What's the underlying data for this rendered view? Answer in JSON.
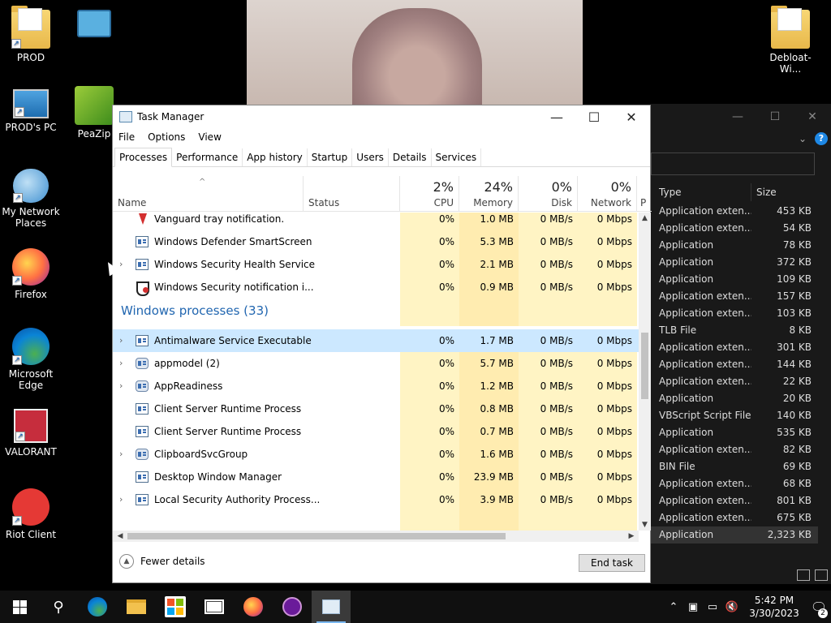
{
  "desktop": {
    "icons": [
      {
        "label": "PROD"
      },
      {
        "label": "PeaZip"
      },
      {
        "label": "PROD's PC"
      },
      {
        "label": "My Network Places"
      },
      {
        "label": "Firefox"
      },
      {
        "label": "Microsoft Edge"
      },
      {
        "label": "VALORANT"
      },
      {
        "label": "Riot Client"
      },
      {
        "label": "Debloat-Wi..."
      }
    ]
  },
  "explorer_bg": {
    "columns": {
      "type": "Type",
      "size": "Size"
    },
    "rows": [
      {
        "type": "Application exten...",
        "size": "453 KB"
      },
      {
        "type": "Application exten...",
        "size": "54 KB"
      },
      {
        "type": "Application",
        "size": "78 KB"
      },
      {
        "type": "Application",
        "size": "372 KB"
      },
      {
        "type": "Application",
        "size": "109 KB"
      },
      {
        "type": "Application exten...",
        "size": "157 KB"
      },
      {
        "type": "Application exten...",
        "size": "103 KB"
      },
      {
        "type": "TLB File",
        "size": "8 KB"
      },
      {
        "type": "Application exten...",
        "size": "301 KB"
      },
      {
        "type": "Application exten...",
        "size": "144 KB"
      },
      {
        "type": "Application exten...",
        "size": "22 KB"
      },
      {
        "type": "Application",
        "size": "20 KB"
      },
      {
        "type": "VBScript Script File",
        "size": "140 KB"
      },
      {
        "type": "Application",
        "size": "535 KB"
      },
      {
        "type": "Application exten...",
        "size": "82 KB"
      },
      {
        "type": "BIN File",
        "size": "69 KB"
      },
      {
        "type": "Application exten...",
        "size": "68 KB"
      },
      {
        "type": "Application exten...",
        "size": "801 KB"
      },
      {
        "type": "Application exten...",
        "size": "675 KB"
      },
      {
        "type": "Application",
        "size": "2,323 KB"
      }
    ]
  },
  "taskmgr": {
    "title": "Task Manager",
    "menu": [
      "File",
      "Options",
      "View"
    ],
    "tabs": [
      "Processes",
      "Performance",
      "App history",
      "Startup",
      "Users",
      "Details",
      "Services"
    ],
    "active_tab": "Processes",
    "headers": {
      "name": "Name",
      "status": "Status",
      "cpu": {
        "pct": "2%",
        "label": "CPU"
      },
      "memory": {
        "pct": "24%",
        "label": "Memory"
      },
      "disk": {
        "pct": "0%",
        "label": "Disk"
      },
      "network": {
        "pct": "0%",
        "label": "Network"
      },
      "power": "P"
    },
    "rows_top": [
      {
        "name": "Vanguard tray notification.",
        "cpu": "0%",
        "mem": "1.0 MB",
        "disk": "0 MB/s",
        "net": "0 Mbps",
        "icon": "vanguard-icon",
        "expandable": false
      },
      {
        "name": "Windows Defender SmartScreen",
        "cpu": "0%",
        "mem": "5.3 MB",
        "disk": "0 MB/s",
        "net": "0 Mbps",
        "icon": "app-icon",
        "expandable": false
      },
      {
        "name": "Windows Security Health Service",
        "cpu": "0%",
        "mem": "2.1 MB",
        "disk": "0 MB/s",
        "net": "0 Mbps",
        "icon": "app-icon",
        "expandable": true
      },
      {
        "name": "Windows Security notification i...",
        "cpu": "0%",
        "mem": "0.9 MB",
        "disk": "0 MB/s",
        "net": "0 Mbps",
        "icon": "security-shield-icon",
        "expandable": false
      }
    ],
    "group": "Windows processes (33)",
    "rows_win": [
      {
        "name": "Antimalware Service Executable",
        "cpu": "0%",
        "mem": "1.7 MB",
        "disk": "0 MB/s",
        "net": "0 Mbps",
        "icon": "app-icon",
        "expandable": true,
        "selected": true
      },
      {
        "name": "appmodel (2)",
        "cpu": "0%",
        "mem": "5.7 MB",
        "disk": "0 MB/s",
        "net": "0 Mbps",
        "icon": "gear-icon",
        "expandable": true
      },
      {
        "name": "AppReadiness",
        "cpu": "0%",
        "mem": "1.2 MB",
        "disk": "0 MB/s",
        "net": "0 Mbps",
        "icon": "gear-icon",
        "expandable": true
      },
      {
        "name": "Client Server Runtime Process",
        "cpu": "0%",
        "mem": "0.8 MB",
        "disk": "0 MB/s",
        "net": "0 Mbps",
        "icon": "app-icon",
        "expandable": false
      },
      {
        "name": "Client Server Runtime Process",
        "cpu": "0%",
        "mem": "0.7 MB",
        "disk": "0 MB/s",
        "net": "0 Mbps",
        "icon": "app-icon",
        "expandable": false
      },
      {
        "name": "ClipboardSvcGroup",
        "cpu": "0%",
        "mem": "1.6 MB",
        "disk": "0 MB/s",
        "net": "0 Mbps",
        "icon": "gear-icon",
        "expandable": true
      },
      {
        "name": "Desktop Window Manager",
        "cpu": "0%",
        "mem": "23.9 MB",
        "disk": "0 MB/s",
        "net": "0 Mbps",
        "icon": "app-icon",
        "expandable": false
      },
      {
        "name": "Local Security Authority Process...",
        "cpu": "0%",
        "mem": "3.9 MB",
        "disk": "0 MB/s",
        "net": "0 Mbps",
        "icon": "app-icon",
        "expandable": true
      }
    ],
    "fewer_details": "Fewer details",
    "end_task": "End task"
  },
  "taskbar": {
    "time": "5:42 PM",
    "date": "3/30/2023",
    "notifications": "2"
  }
}
